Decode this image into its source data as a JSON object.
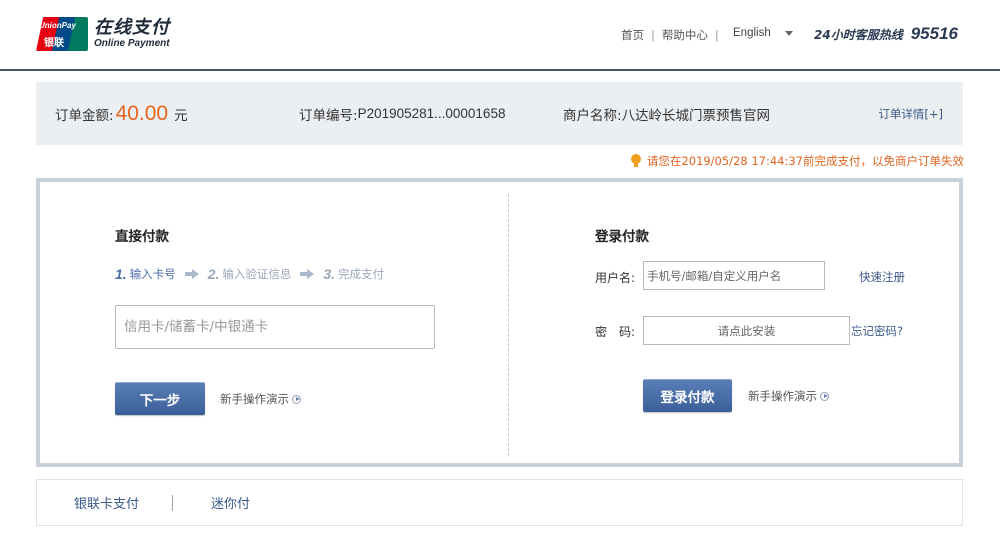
{
  "header": {
    "logo": {
      "badge_top": "UnionPay",
      "badge_bottom": "银联",
      "title_cn": "在线支付",
      "title_en": "Online Payment"
    },
    "nav": {
      "home": "首页",
      "help": "帮助中心"
    },
    "language": "English",
    "hotline_label": "24小时客服热线",
    "hotline_number": "95516"
  },
  "order": {
    "amount_label": "订单金额:",
    "amount_value": "40.00",
    "amount_unit": "元",
    "number_label": "订单编号:",
    "number_value": "P201905281...00001658",
    "merchant_label": "商户名称:",
    "merchant_value": "八达岭长城门票预售官网",
    "detail_link": "订单详情[+]"
  },
  "deadline_notice": "请您在2019/05/28 17:44:37前完成支付，以免商户订单失效",
  "direct_pay": {
    "title": "直接付款",
    "steps": [
      {
        "num": "1.",
        "label": "输入卡号"
      },
      {
        "num": "2.",
        "label": "输入验证信息"
      },
      {
        "num": "3.",
        "label": "完成支付"
      }
    ],
    "card_placeholder": "信用卡/储蓄卡/中银通卡",
    "next_button": "下一步",
    "guide_link": "新手操作演示"
  },
  "login_pay": {
    "title": "登录付款",
    "username_label": "用户名:",
    "username_placeholder": "手机号/邮箱/自定义用户名",
    "register_link": "快速注册",
    "password_label": "密　码:",
    "password_placeholder": "请点此安装",
    "forgot_link": "忘记密码?",
    "login_button": "登录付款",
    "guide_link": "新手操作演示"
  },
  "bottom_tabs": [
    "银联卡支付",
    "迷你付"
  ],
  "colors": {
    "accent_orange": "#e8641b",
    "button_blue": "#4a6ea8",
    "link_blue": "#3a5a8a",
    "bar_gray": "#eceff2"
  }
}
